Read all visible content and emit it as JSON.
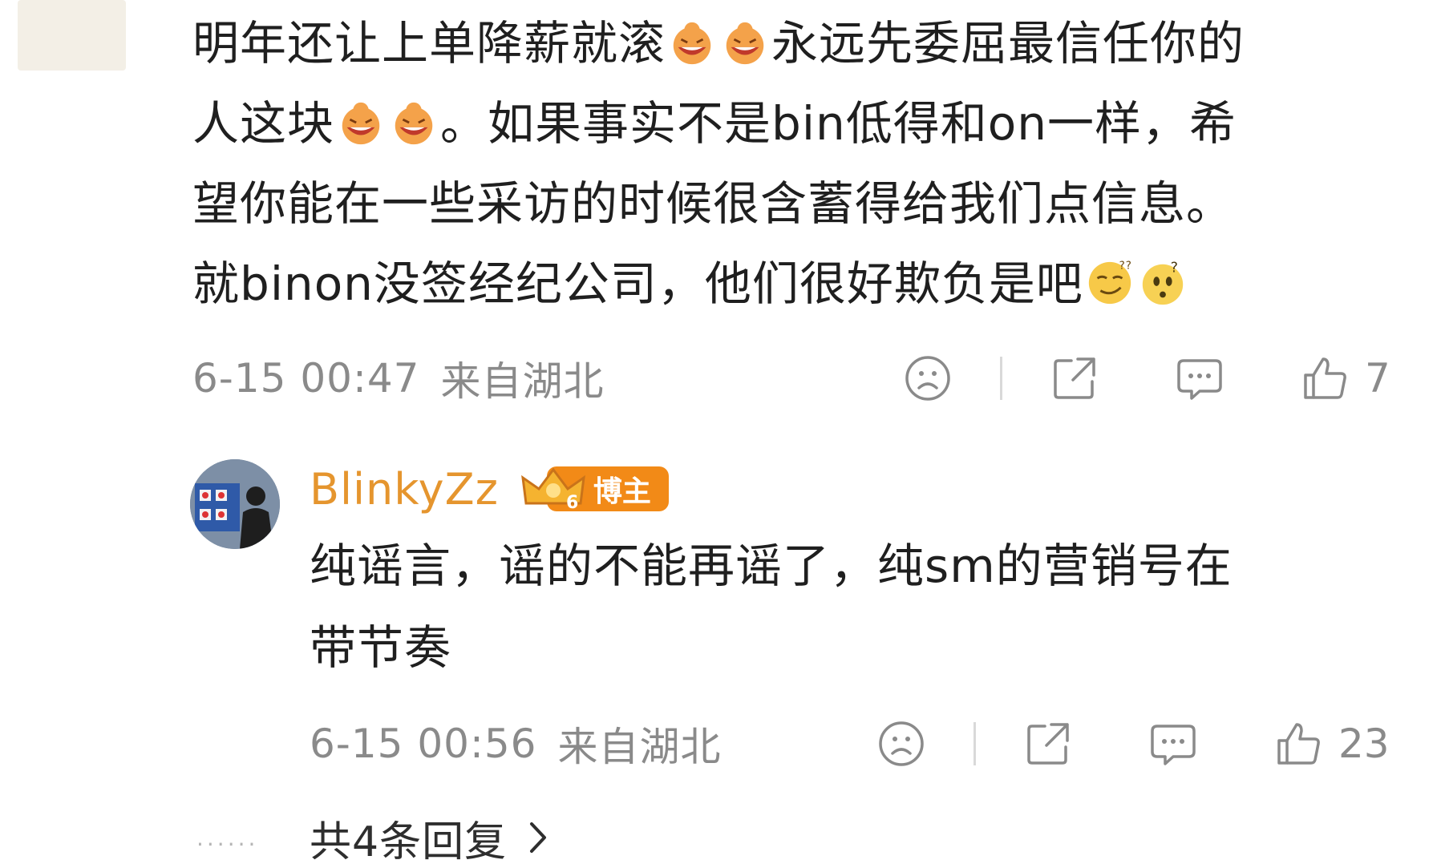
{
  "comment": {
    "text_line1a": "明年还让上单降薪就滚",
    "text_line1b": "永远先委屈最信任你的",
    "text_line2a": "人这块",
    "text_line2b": "。如果事实不是bin低得和on一样，希",
    "text_line3": "望你能在一些采访的时候很含蓄得给我们点信息。",
    "text_line4": "就binon没签经纪公司，他们很好欺负是吧",
    "time": "6-15 00:47",
    "location": "来自湖北",
    "like_count": "7"
  },
  "reply": {
    "user_name": "BlinkyZz",
    "badge_label": "博主",
    "text_line1": "纯谣言，谣的不能再谣了，纯sm的营销号在",
    "text_line2": "带节奏",
    "time": "6-15 00:56",
    "location": "来自湖北",
    "like_count": "23"
  },
  "footer": {
    "more_replies": "共4条回复"
  },
  "icons": {
    "dislike": "sad-face-icon",
    "share": "share-icon",
    "comment": "comment-bubble-icon",
    "like": "thumbs-up-icon",
    "chevron": "chevron-right-icon",
    "emoji_laugh": "laughing-emoji-icon",
    "emoji_smirk": "smirk-emoji-icon",
    "emoji_confused": "confused-emoji-icon"
  },
  "colors": {
    "username": "#e5952e",
    "badge": "#f28a17",
    "meta": "#8a8a8a"
  }
}
